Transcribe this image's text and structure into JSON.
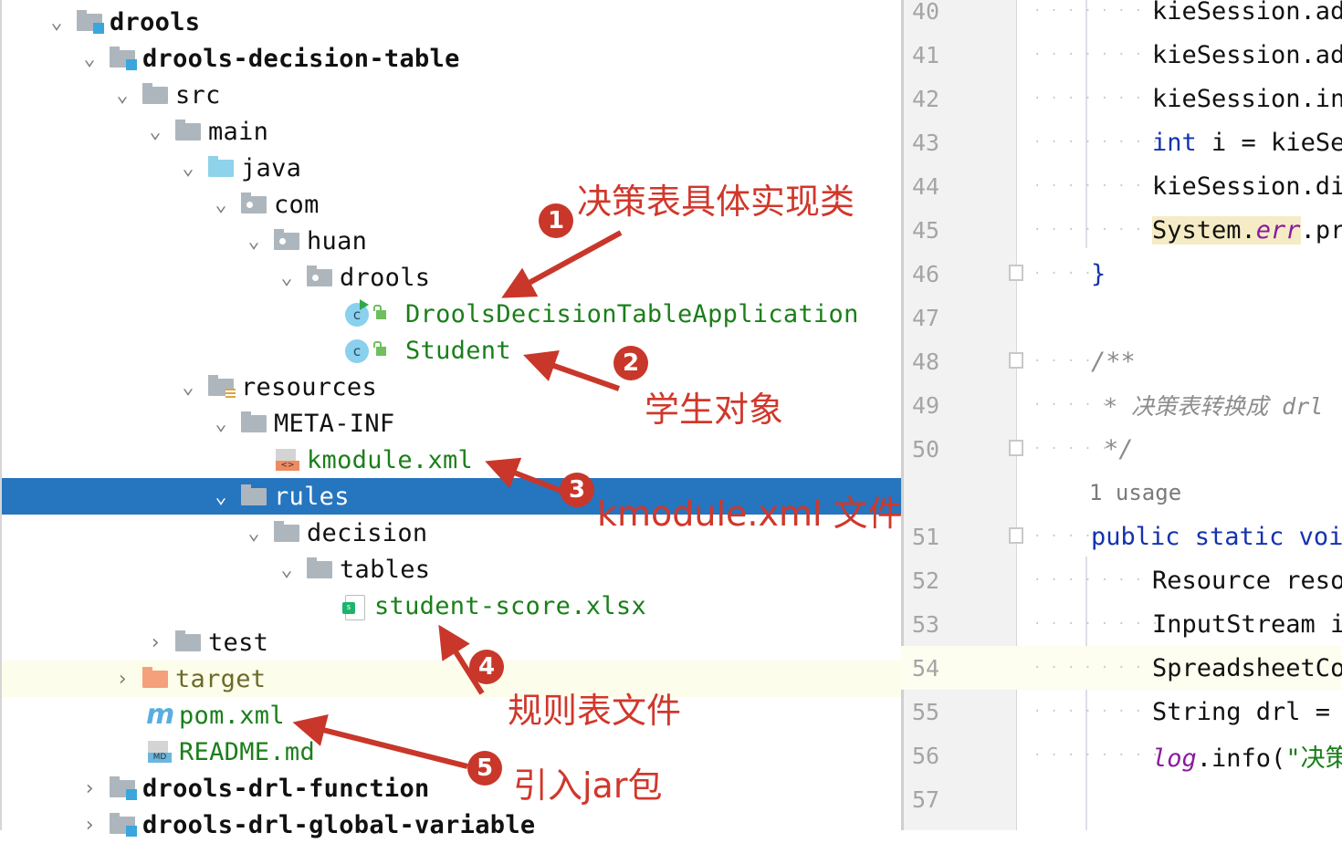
{
  "project_tree": {
    "items": [
      {
        "label": "drools",
        "level": 0,
        "expanded": true,
        "icon": "module-folder-icon",
        "style": "bold"
      },
      {
        "label": "drools-decision-table",
        "level": 1,
        "expanded": true,
        "icon": "module-folder-icon",
        "style": "bold"
      },
      {
        "label": "src",
        "level": 2,
        "expanded": true,
        "icon": "folder-icon"
      },
      {
        "label": "main",
        "level": 3,
        "expanded": true,
        "icon": "folder-icon"
      },
      {
        "label": "java",
        "level": 4,
        "expanded": true,
        "icon": "source-folder-icon"
      },
      {
        "label": "com",
        "level": 5,
        "expanded": true,
        "icon": "package-icon"
      },
      {
        "label": "huan",
        "level": 6,
        "expanded": true,
        "icon": "package-icon"
      },
      {
        "label": "drools",
        "level": 7,
        "expanded": true,
        "icon": "package-icon"
      },
      {
        "label": "DroolsDecisionTableApplication",
        "level": 8,
        "icon": "runnable-class-icon",
        "style": "green"
      },
      {
        "label": "Student",
        "level": 8,
        "icon": "class-icon",
        "style": "green"
      },
      {
        "label": "resources",
        "level": 4,
        "expanded": true,
        "icon": "resources-folder-icon"
      },
      {
        "label": "META-INF",
        "level": 5,
        "expanded": true,
        "icon": "folder-icon"
      },
      {
        "label": "kmodule.xml",
        "level": 6,
        "icon": "xml-file-icon",
        "style": "green"
      },
      {
        "label": "rules",
        "level": 5,
        "expanded": true,
        "icon": "folder-icon",
        "selected": true
      },
      {
        "label": "decision",
        "level": 6,
        "expanded": true,
        "icon": "folder-icon"
      },
      {
        "label": "tables",
        "level": 7,
        "expanded": true,
        "icon": "folder-icon"
      },
      {
        "label": "student-score.xlsx",
        "level": 8,
        "icon": "spreadsheet-file-icon",
        "style": "green"
      },
      {
        "label": "test",
        "level": 3,
        "expanded": false,
        "icon": "folder-icon"
      },
      {
        "label": "target",
        "level": 2,
        "expanded": false,
        "icon": "excluded-folder-icon",
        "style": "olive",
        "highlighted": true
      },
      {
        "label": "pom.xml",
        "level": 2,
        "icon": "maven-file-icon",
        "style": "green"
      },
      {
        "label": "README.md",
        "level": 2,
        "icon": "markdown-file-icon",
        "style": "green"
      },
      {
        "label": "drools-drl-function",
        "level": 1,
        "expanded": false,
        "icon": "module-folder-icon",
        "style": "bold"
      },
      {
        "label": "drools-drl-global-variable",
        "level": 1,
        "expanded": false,
        "icon": "module-folder-icon",
        "style": "bold"
      }
    ]
  },
  "editor": {
    "lines": [
      {
        "num": "40",
        "text": "kieSession.ad"
      },
      {
        "num": "41",
        "text": "kieSession.ad"
      },
      {
        "num": "42",
        "text": "kieSession.in"
      },
      {
        "num": "43",
        "kw": "int",
        "text": " i = kieSe"
      },
      {
        "num": "44",
        "text": "kieSession.di"
      },
      {
        "num": "45",
        "sys": "System.",
        "err": "err",
        "text": ".pr"
      },
      {
        "num": "46",
        "text": "}"
      },
      {
        "num": "47",
        "text": ""
      },
      {
        "num": "48",
        "text": "/**"
      },
      {
        "num": "49",
        "text": "* 决策表转换成 drl"
      },
      {
        "num": "50",
        "text": "*/"
      },
      {
        "num": "51",
        "text": "public static voi"
      },
      {
        "num": "52",
        "text": "Resource reso"
      },
      {
        "num": "53",
        "text": "InputStream i"
      },
      {
        "num": "54",
        "text": "SpreadsheetCo"
      },
      {
        "num": "55",
        "text": "String drl = "
      },
      {
        "num": "56",
        "log": "log",
        "text": ".info(",
        "str": "\"决策"
      },
      {
        "num": "57",
        "text": ""
      }
    ],
    "usage_hint": "1 usage"
  },
  "annotations": [
    {
      "badge": "1",
      "text": "决策表具体实现类"
    },
    {
      "badge": "2",
      "text": "学生对象"
    },
    {
      "badge": "3",
      "text": "kmodule.xml 文件"
    },
    {
      "badge": "4",
      "text": "规则表文件"
    },
    {
      "badge": "5",
      "text": "引入jar包"
    }
  ],
  "colors": {
    "selection": "#2675bf",
    "annotation_red": "#d0382b",
    "file_green": "#1a7f1a",
    "keyword_blue": "#1432b0"
  }
}
